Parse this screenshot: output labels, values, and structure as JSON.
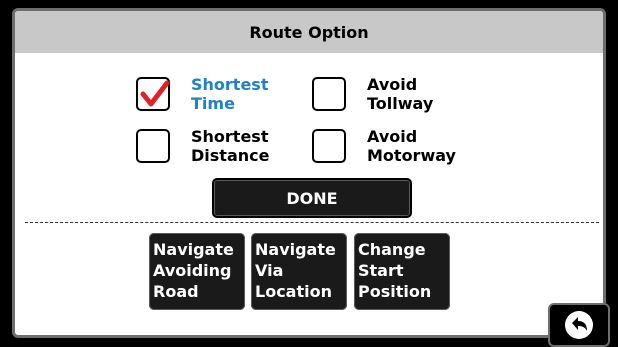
{
  "dialog": {
    "title": "Route Option"
  },
  "options": [
    {
      "label": "Shortest\nTime",
      "checked": true
    },
    {
      "label": "Avoid\nTollway",
      "checked": false
    },
    {
      "label": "Shortest\nDistance",
      "checked": false
    },
    {
      "label": "Avoid\nMotorway",
      "checked": false
    }
  ],
  "buttons": {
    "done": "DONE",
    "navigate_avoiding_road": "Navigate\nAvoiding\nRoad",
    "navigate_via_location": "Navigate\nVia\nLocation",
    "change_start_position": "Change\nStart\nPosition"
  },
  "icons": {
    "checkmark": "checkmark-icon",
    "back": "back-arrow-icon"
  },
  "colors": {
    "selected_text": "#1e82c8",
    "checkmark": "#e0202a",
    "header_bg": "#c8c8c8"
  }
}
